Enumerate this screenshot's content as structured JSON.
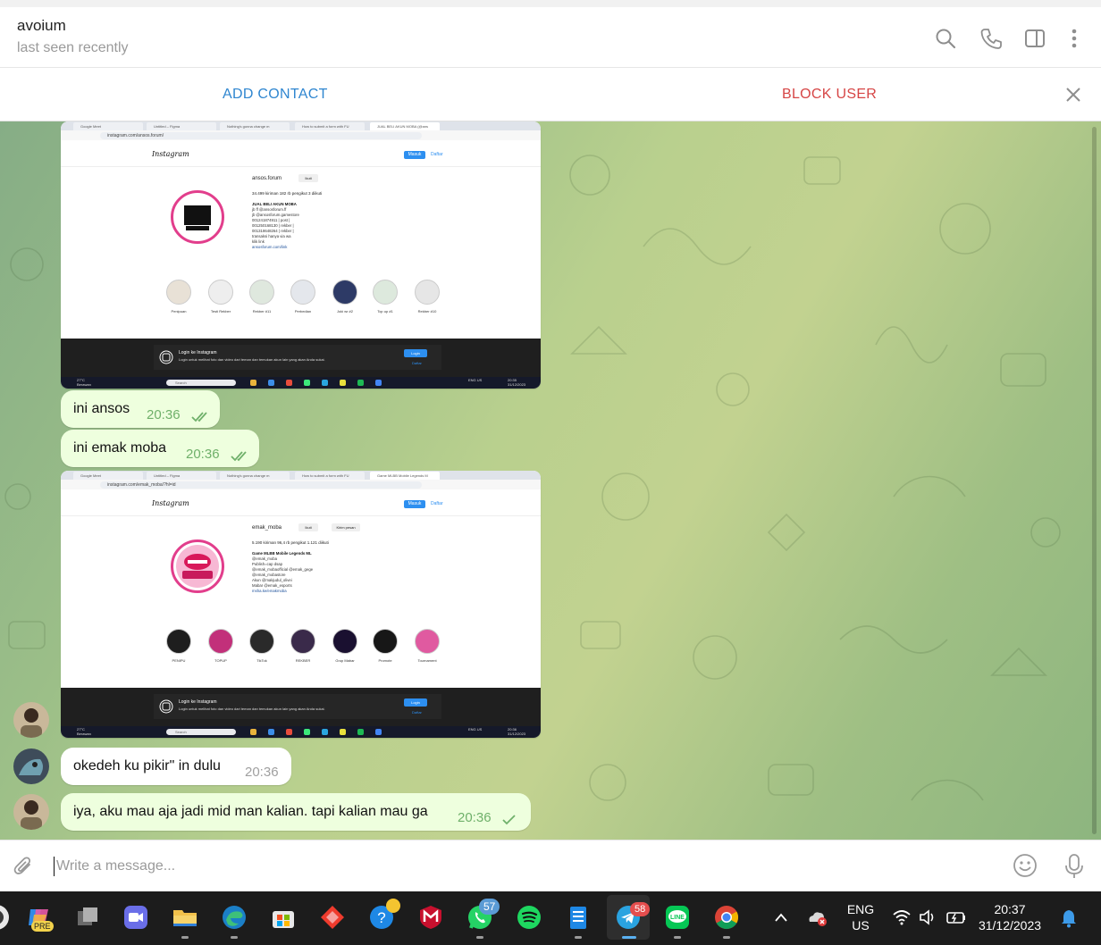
{
  "header": {
    "contact_name": "avoium",
    "status": "last seen recently",
    "icons": [
      "search-icon",
      "phone-icon",
      "sidebar-toggle-icon",
      "more-vertical-icon"
    ]
  },
  "action_bar": {
    "add_contact": "ADD CONTACT",
    "block_user": "BLOCK USER",
    "close_icon": "close-icon"
  },
  "messages": [
    {
      "kind": "screenshot",
      "tabs": [
        "Google Meet",
        "Untitled – Figma",
        "Nothing's gonna change m",
        "How to submit a form with FU",
        "JUAL BELI AKUN MOBA (@ans"
      ],
      "url": "instagram.com/ansos.forum/",
      "ig_logo": "Instagram",
      "masuk": "Masuk",
      "daftar": "Daftar",
      "username": "ansos.forum",
      "follow_btn": "Ikuti",
      "stats": "34.499 kiriman      182 rb pengikut      3 diikuti",
      "bio_title": "JUAL BELI AKUN MOBA",
      "bio_lines": [
        "jb ff @ansosforum.ff",
        "jb @ansosforum.gamestore",
        "001241874911 | post |",
        "001250168130 | rekber |",
        "001318648264 | rekber |",
        "transaksi hanya via wa",
        "klik link"
      ],
      "bio_link": "ansosforum.com/link",
      "highlights": [
        "Penipuan",
        "Testi Rekber",
        "Rekber #11",
        "Perbedian",
        "Joki wr #2",
        "Top up #1",
        "Rekber #10"
      ],
      "login_title": "Login ke Instagram",
      "login_sub": "Login untuk melihat foto dan video dari teman dan temukan akun lain yang akan Anda sukai.",
      "login_btn": "Login",
      "login_daftar": "Daftar",
      "weather": "27°C",
      "weather_sub": "Berawan",
      "search": "Search",
      "tray_lang": "ENG US",
      "tray_time": "20:35",
      "tray_date": "31/12/2023"
    },
    {
      "kind": "text",
      "direction": "out",
      "text": "ini ansos",
      "time": "20:36",
      "read": true
    },
    {
      "kind": "text",
      "direction": "out",
      "text": "ini emak moba",
      "time": "20:36",
      "read": true
    },
    {
      "kind": "screenshot",
      "tabs": [
        "Google Meet",
        "Untitled – Figma",
        "Nothing's gonna change m",
        "How to submit a form with FU",
        "Game MLBB Mobile Legends M"
      ],
      "url": "instagram.com/emak_moba/?hl=id",
      "ig_logo": "Instagram",
      "masuk": "Masuk",
      "daftar": "Daftar",
      "username": "emak_moba",
      "follow_btn": "Ikuti",
      "message_btn": "Kirim pesan",
      "stats": "5.190 kiriman      96,4 rb pengikut      1.121 diikuti",
      "bio_title": "Game MLBB Mobile Legends ML",
      "bio_lines": [
        "@emak_moba",
        "Publish=cap dsap",
        "@emak_mobaofficial @emak_gege",
        "@emak_mobastore",
        "Akun @makjudul_olivei",
        "Mabar @emak_esports"
      ],
      "bio_link": "msha.ke/emakmoba",
      "highlights": [
        "PENIPU",
        "TOPUP",
        "TikTok",
        "REKBER",
        "Grup Mabar",
        "Promote",
        "Tournament"
      ],
      "login_title": "Login ke Instagram",
      "login_sub": "Login untuk melihat foto dan video dari teman dan temukan akun lain yang akan Anda sukai.",
      "login_btn": "Login",
      "login_daftar": "Daftar",
      "weather": "27°C",
      "weather_sub": "Berawan",
      "search": "Search",
      "tray_lang": "ENG US",
      "tray_time": "20:36",
      "tray_date": "31/12/2023"
    },
    {
      "kind": "text",
      "direction": "in",
      "text": "okedeh ku pikir\" in dulu",
      "time": "20:36"
    },
    {
      "kind": "text",
      "direction": "out",
      "text": "iya, aku mau aja jadi mid man kalian. tapi kalian mau ga",
      "time": "20:36",
      "read": false
    }
  ],
  "composer": {
    "placeholder": "Write a message...",
    "icons": [
      "attach-icon",
      "emoji-icon",
      "microphone-icon"
    ]
  },
  "taskbar": {
    "apps": [
      "copilot-icon",
      "task-view-icon",
      "zoom-icon",
      "file-explorer-icon",
      "edge-icon",
      "microsoft-store-icon",
      "anydesk-icon",
      "help-icon",
      "mcafee-icon",
      "whatsapp-icon",
      "spotify-icon",
      "notepad-icon",
      "telegram-icon",
      "line-icon",
      "chrome-icon"
    ],
    "copilot_badge": "PRE",
    "whatsapp_badge": "57",
    "telegram_badge": "58",
    "lang_top": "ENG",
    "lang_bottom": "US",
    "time": "20:37",
    "date": "31/12/2023"
  }
}
